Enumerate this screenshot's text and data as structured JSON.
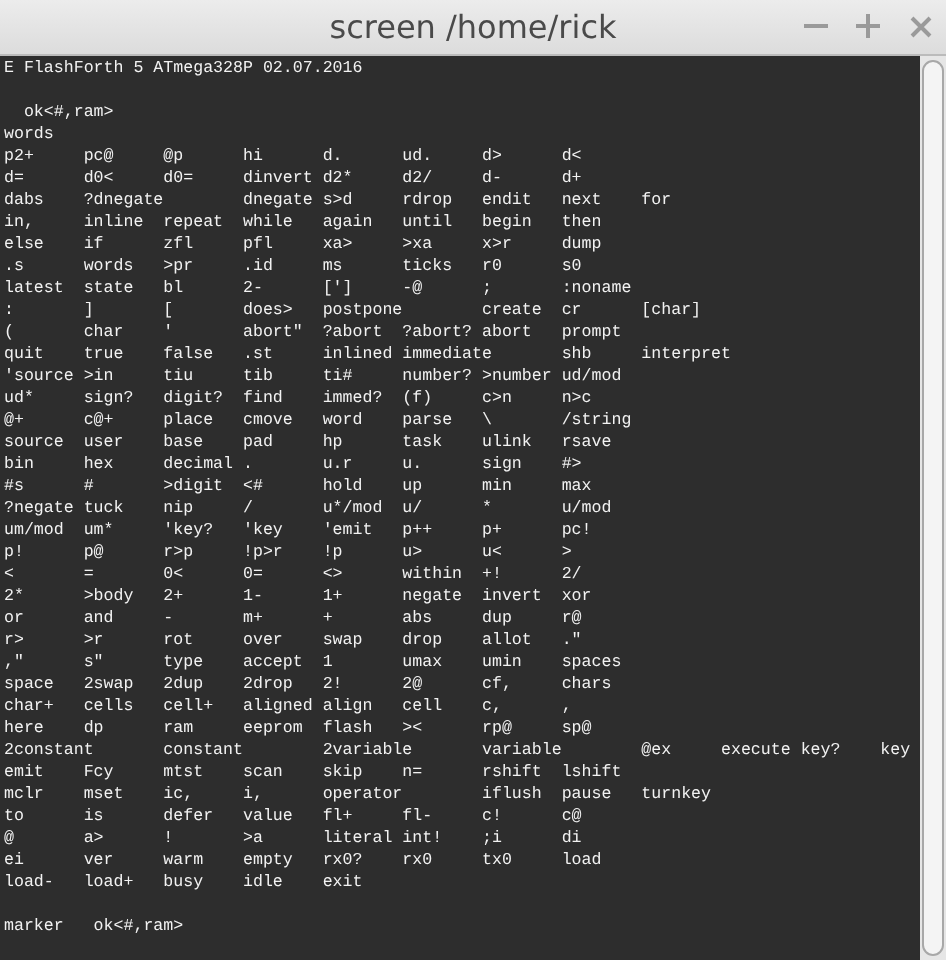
{
  "window": {
    "title": "screen  /home/rick"
  },
  "terminal": {
    "banner": "E FlashForth 5 ATmega328P 02.07.2016",
    "prompt": "  ok<#,ram>",
    "command": "words",
    "output_lines": [
      "p2+     pc@     @p      hi      d.      ud.     d>      d<",
      "d=      d0<     d0=     dinvert d2*     d2/     d-      d+",
      "dabs    ?dnegate        dnegate s>d     rdrop   endit   next    for",
      "in,     inline  repeat  while   again   until   begin   then",
      "else    if      zfl     pfl     xa>     >xa     x>r     dump",
      ".s      words   >pr     .id     ms      ticks   r0      s0",
      "latest  state   bl      2-      [']     -@      ;       :noname",
      ":       ]       [       does>   postpone        create  cr      [char]",
      "(       char    '       abort\"  ?abort  ?abort? abort   prompt",
      "quit    true    false   .st     inlined immediate       shb     interpret",
      "'source >in     tiu     tib     ti#     number? >number ud/mod",
      "ud*     sign?   digit?  find    immed?  (f)     c>n     n>c",
      "@+      c@+     place   cmove   word    parse   \\       /string",
      "source  user    base    pad     hp      task    ulink   rsave",
      "bin     hex     decimal .       u.r     u.      sign    #>",
      "#s      #       >digit  <#      hold    up      min     max",
      "?negate tuck    nip     /       u*/mod  u/      *       u/mod",
      "um/mod  um*     'key?   'key    'emit   p++     p+      pc!",
      "p!      p@      r>p     !p>r    !p      u>      u<      >",
      "<       =       0<      0=      <>      within  +!      2/",
      "2*      >body   2+      1-      1+      negate  invert  xor",
      "or      and     -       m+      +       abs     dup     r@",
      "r>      >r      rot     over    swap    drop    allot   .\"",
      ",\"      s\"      type    accept  1       umax    umin    spaces",
      "space   2swap   2dup    2drop   2!      2@      cf,     chars",
      "char+   cells   cell+   aligned align   cell    c,      ,",
      "here    dp      ram     eeprom  flash   ><      rp@     sp@",
      "2constant       constant        2variable       variable        @ex     execute key?    key",
      "emit    Fcy     mtst    scan    skip    n=      rshift  lshift",
      "mclr    mset    ic,     i,      operator        iflush  pause   turnkey",
      "to      is      defer   value   fl+     fl-     c!      c@",
      "@       a>      !       >a      literal int!    ;i      di",
      "ei      ver     warm    empty   rx0?    rx0     tx0     load",
      "load-   load+   busy    idle    exit"
    ],
    "final_line": "marker   ok<#,ram>"
  }
}
